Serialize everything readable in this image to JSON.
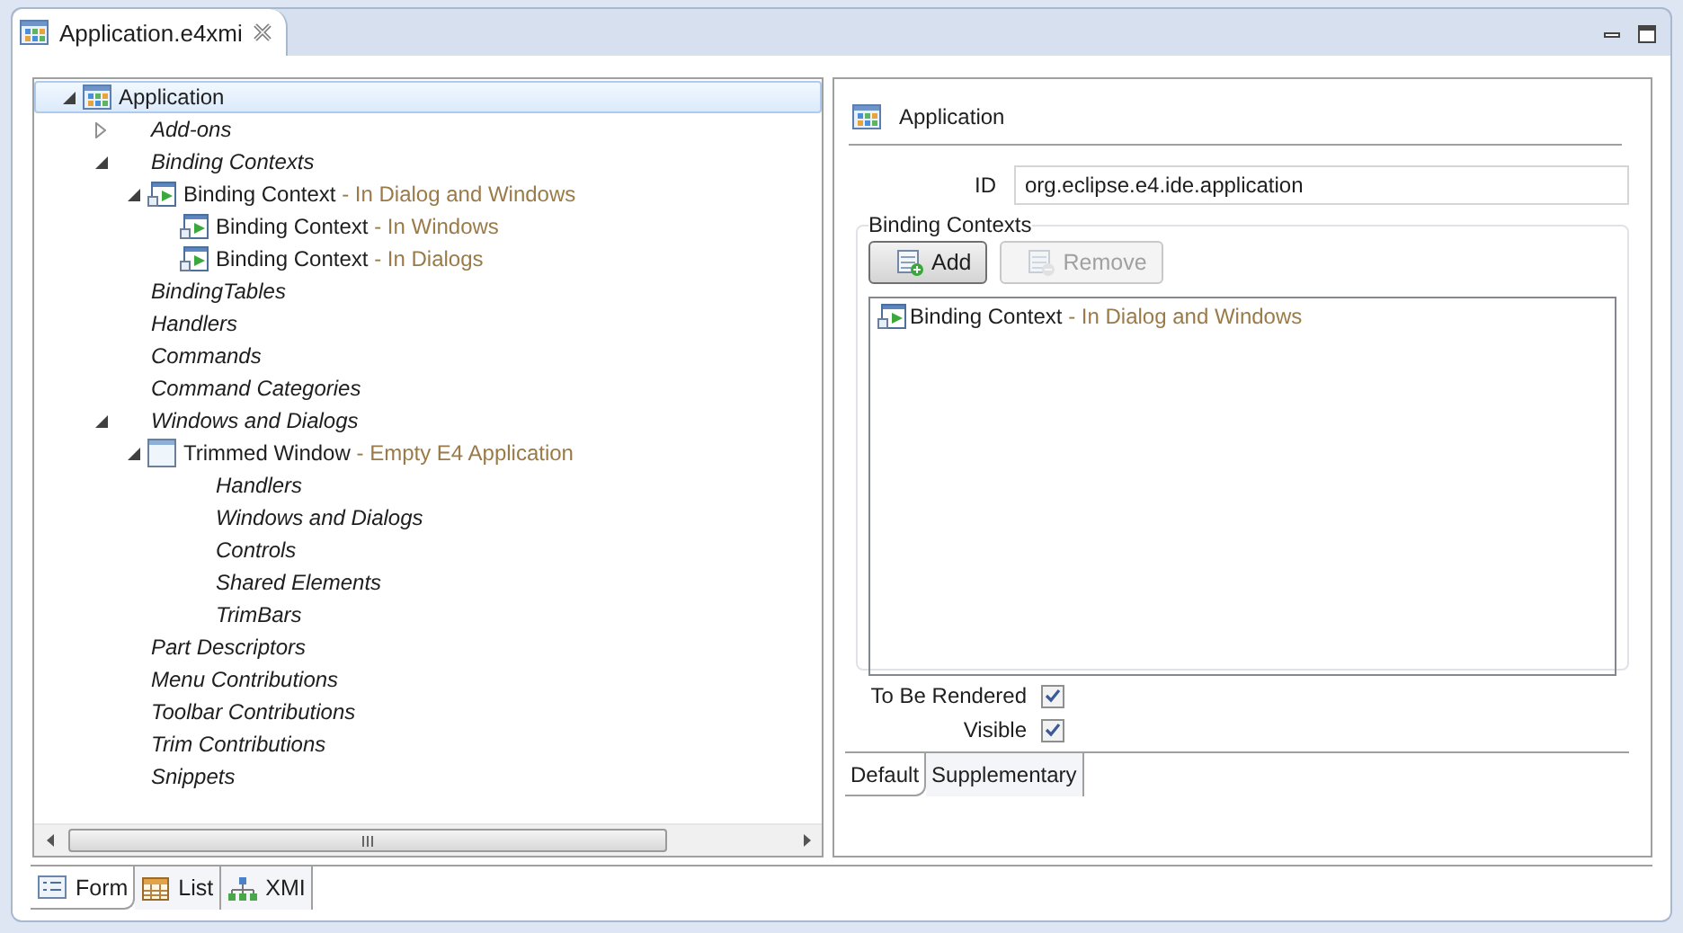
{
  "editor_tab": {
    "title": "Application.e4xmi"
  },
  "tree": [
    {
      "kind": "application",
      "label": "Application",
      "selected": true,
      "expanded": true,
      "children": [
        {
          "kind": "folder",
          "label": "Add-ons",
          "selected": false,
          "expanded": false
        },
        {
          "kind": "folder",
          "label": "Binding Contexts",
          "selected": false,
          "expanded": true,
          "children": [
            {
              "kind": "binding_context",
              "label": "Binding Context",
              "detail": "- In Dialog and Windows",
              "selected": false,
              "expanded": true,
              "children": [
                {
                  "kind": "binding_context",
                  "label": "Binding Context",
                  "detail": "- In Windows",
                  "selected": false
                },
                {
                  "kind": "binding_context",
                  "label": "Binding Context",
                  "detail": "- In Dialogs",
                  "selected": false
                }
              ]
            }
          ]
        },
        {
          "kind": "folder",
          "label": "BindingTables",
          "selected": false
        },
        {
          "kind": "folder",
          "label": "Handlers",
          "selected": false
        },
        {
          "kind": "folder",
          "label": "Commands",
          "selected": false
        },
        {
          "kind": "folder",
          "label": "Command Categories",
          "selected": false
        },
        {
          "kind": "folder",
          "label": "Windows and Dialogs",
          "selected": false,
          "expanded": true,
          "children": [
            {
              "kind": "window",
              "label": "Trimmed Window",
              "detail": "- Empty E4 Application",
              "selected": false,
              "expanded": true,
              "children": [
                {
                  "kind": "folder",
                  "label": "Handlers",
                  "selected": false
                },
                {
                  "kind": "folder",
                  "label": "Windows and Dialogs",
                  "selected": false
                },
                {
                  "kind": "folder",
                  "label": "Controls",
                  "selected": false
                },
                {
                  "kind": "folder",
                  "label": "Shared Elements",
                  "selected": false
                },
                {
                  "kind": "folder",
                  "label": "TrimBars",
                  "selected": false
                }
              ]
            }
          ]
        },
        {
          "kind": "folder",
          "label": "Part Descriptors",
          "selected": false
        },
        {
          "kind": "folder",
          "label": "Menu Contributions",
          "selected": false
        },
        {
          "kind": "folder",
          "label": "Toolbar Contributions",
          "selected": false
        },
        {
          "kind": "folder",
          "label": "Trim Contributions",
          "selected": false
        },
        {
          "kind": "folder",
          "label": "Snippets",
          "selected": false
        }
      ]
    }
  ],
  "detail": {
    "title": "Application",
    "id_label": "ID",
    "id_value": "org.eclipse.e4.ide.application",
    "group": {
      "title": "Binding Contexts",
      "buttons": [
        {
          "label": "Add",
          "disabled": false
        },
        {
          "label": "Remove",
          "disabled": true
        }
      ],
      "items": [
        {
          "label": "Binding Context",
          "detail": "- In Dialog and Windows"
        }
      ]
    },
    "checks": [
      {
        "label": "To Be Rendered",
        "checked": true
      },
      {
        "label": "Visible",
        "checked": true
      }
    ],
    "tabs": [
      {
        "label": "Default",
        "selected": true
      },
      {
        "label": "Supplementary",
        "selected": false
      }
    ]
  },
  "bottom_tabs": [
    {
      "label": "Form",
      "selected": true
    },
    {
      "label": "List",
      "selected": false
    },
    {
      "label": "XMI",
      "selected": false
    }
  ]
}
